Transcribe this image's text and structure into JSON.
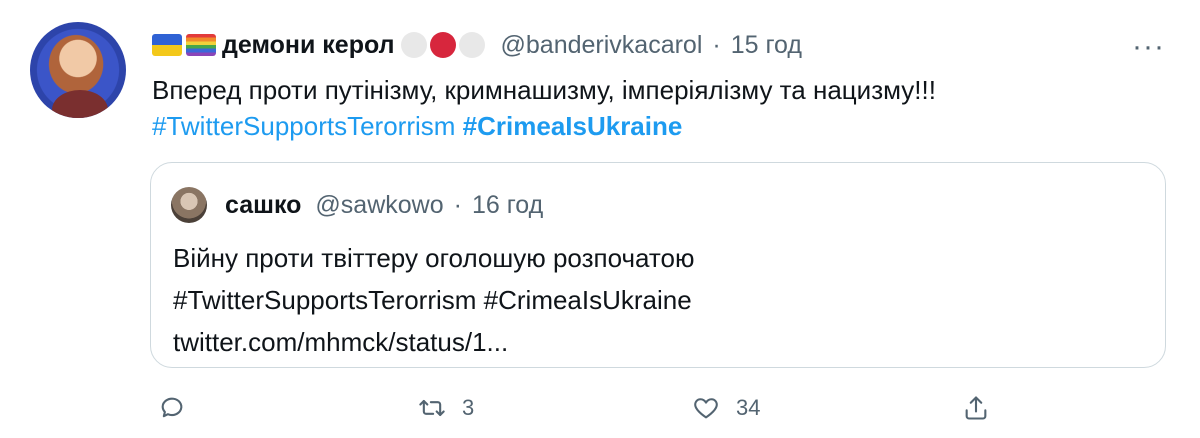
{
  "author": {
    "flags": [
      "ukraine-flag",
      "rainbow-flag"
    ],
    "name": "демони керол",
    "badges": [
      "white-circle",
      "red-circle",
      "white-circle"
    ],
    "handle": "@banderivkacarol",
    "time": "15 год",
    "more_icon": "more-dots-icon"
  },
  "tweet": {
    "text": "Вперед проти путінізму, кримнашизму, імперіялізму та нацизму!!!",
    "hashtag1": "#TwitterSupportsTerorrism",
    "hashtag2": "#CrimeaIsUkraine"
  },
  "quote": {
    "name": "сашко",
    "handle": "@sawkowo",
    "time": "16 год",
    "line1": "Війну проти твіттеру оголошую розпочатою",
    "line2": "#TwitterSupportsTerorrism #CrimeaIsUkraine",
    "line3": "twitter.com/mhmck/status/1..."
  },
  "actions": {
    "reply": {
      "icon": "reply-icon",
      "count": ""
    },
    "retweet": {
      "icon": "retweet-icon",
      "count": "3"
    },
    "like": {
      "icon": "heart-icon",
      "count": "34"
    },
    "share": {
      "icon": "share-icon",
      "count": ""
    }
  },
  "colors": {
    "link": "#1d9bf0",
    "muted": "#536471",
    "text": "#0f1419",
    "border": "#cfd9de"
  }
}
